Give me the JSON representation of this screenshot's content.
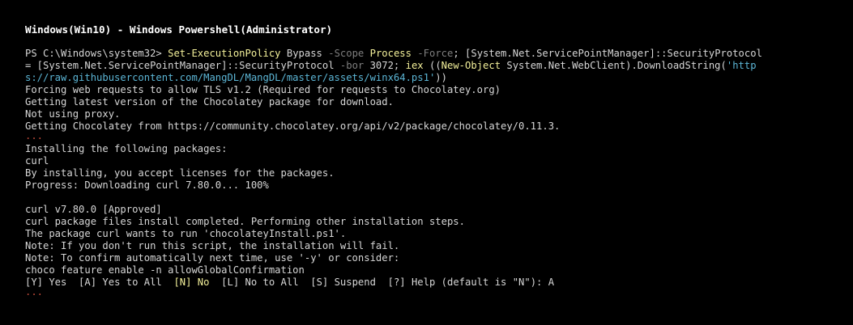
{
  "window": {
    "title": "Windows(Win10) - Windows Powershell(Administrator)"
  },
  "command": {
    "prompt": "PS C:\\Windows\\system32> ",
    "cmdlet": "Set-ExecutionPolicy",
    "arg_bypass": " Bypass ",
    "param_scope": "-Scope",
    "sp1": " ",
    "arg_process": "Process",
    "sp2": " ",
    "param_force": "-Force",
    "rest1": "; [System.Net.ServicePointManager]::SecurityProtocol",
    "line2_a": "= [System.Net.ServicePointManager]::SecurityProtocol ",
    "param_bor": "-bor",
    "line2_b": " 3072; ",
    "iex": "iex",
    "line2_c": " ((",
    "new_object": "New-Object",
    "line2_d": " System.Net.WebClient).DownloadString(",
    "url_part1": "'http",
    "url_part2": "s://raw.githubusercontent.com/MangDL/MangDL/master/assets/winx64.ps1'",
    "line3_end": "))"
  },
  "output": {
    "lines_a": [
      "Forcing web requests to allow TLS v1.2 (Required for requests to Chocolatey.org)",
      "Getting latest version of the Chocolatey package for download.",
      "Not using proxy.",
      "Getting Chocolatey from https://community.chocolatey.org/api/v2/package/chocolatey/0.11.3."
    ],
    "ellipsis": "...",
    "lines_b": [
      "Installing the following packages:",
      "curl",
      "By installing, you accept licenses for the packages.",
      "Progress: Downloading curl 7.80.0... 100%"
    ],
    "lines_c": [
      "curl v7.80.0 [Approved]",
      "curl package files install completed. Performing other installation steps.",
      "The package curl wants to run 'chocolateyInstall.ps1'.",
      "Note: If you don't run this script, the installation will fail.",
      "Note: To confirm automatically next time, use '-y' or consider:",
      "choco feature enable -n allowGlobalConfirmation"
    ],
    "choices": {
      "yes": "[Y] Yes  ",
      "yes_all": "[A] Yes to All  ",
      "no": "[N] No",
      "gap": "  ",
      "no_all": "[L] No to All  ",
      "suspend": "[S] Suspend  ",
      "help": "[?] Help (default is \"N\"): ",
      "answer": "A"
    }
  },
  "colors": {
    "background": "#000000",
    "text": "#d6d6d6",
    "cmdlet": "#f3f09a",
    "parameter": "#7e7e7e",
    "string": "#5cb6d6",
    "ellipsis": "#c24b3a"
  }
}
